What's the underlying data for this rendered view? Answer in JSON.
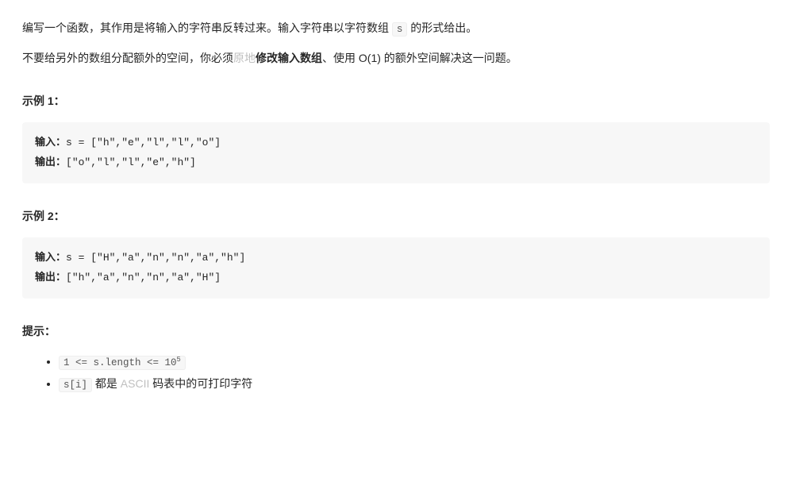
{
  "intro": {
    "line1_pre": "编写一个函数，其作用是将输入的字符串反转过来。输入字符串以字符数组 ",
    "line1_code": "s",
    "line1_post": " 的形式给出。",
    "line2_pre": "不要给另外的数组分配额外的空间，你必须",
    "line2_link": "原地",
    "line2_bold": "修改输入数组",
    "line2_post": "、使用 O(1) 的额外空间解决这一问题。"
  },
  "example1": {
    "heading": "示例 1：",
    "input_label": "输入：",
    "input_value": "s = [\"h\",\"e\",\"l\",\"l\",\"o\"]",
    "output_label": "输出：",
    "output_value": "[\"o\",\"l\",\"l\",\"e\",\"h\"]"
  },
  "example2": {
    "heading": "示例 2：",
    "input_label": "输入：",
    "input_value": "s = [\"H\",\"a\",\"n\",\"n\",\"a\",\"h\"]",
    "output_label": "输出：",
    "output_value": "[\"h\",\"a\",\"n\",\"n\",\"a\",\"H\"]"
  },
  "hints": {
    "heading": "提示：",
    "item1_code_pre": "1 <= s.length <= 10",
    "item1_code_sup": "5",
    "item2_code": "s[i]",
    "item2_text_pre": " 都是 ",
    "item2_text_gray": "ASCII",
    "item2_text_post": " 码表中的可打印字符"
  }
}
